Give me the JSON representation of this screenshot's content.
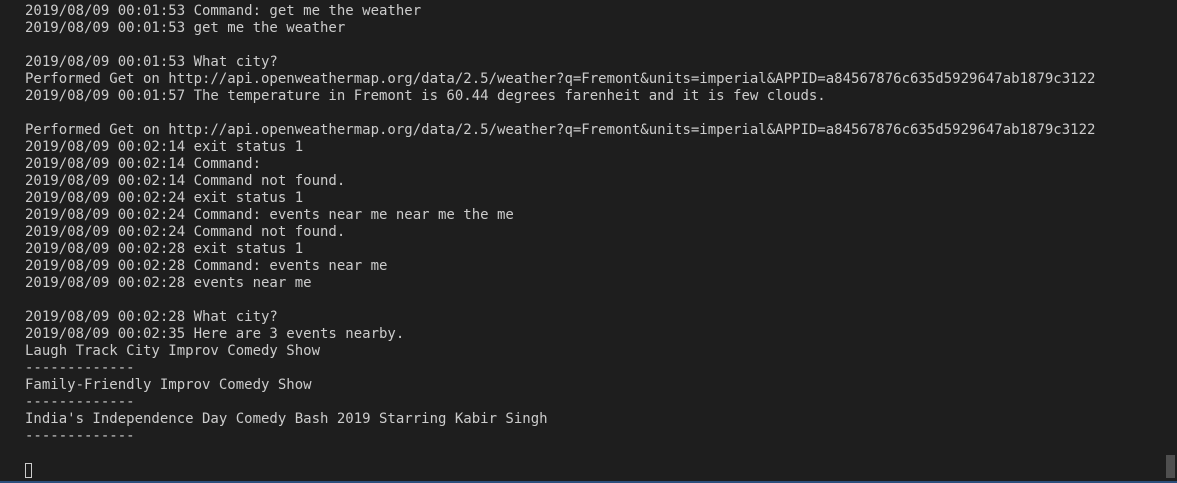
{
  "terminal": {
    "lines": [
      "2019/08/09 00:01:53 Command: get me the weather",
      "2019/08/09 00:01:53 get me the weather",
      "",
      "2019/08/09 00:01:53 What city?",
      "Performed Get on http://api.openweathermap.org/data/2.5/weather?q=Fremont&units=imperial&APPID=a84567876c635d5929647ab1879c3122",
      "2019/08/09 00:01:57 The temperature in Fremont is 60.44 degrees farenheit and it is few clouds.",
      "",
      "Performed Get on http://api.openweathermap.org/data/2.5/weather?q=Fremont&units=imperial&APPID=a84567876c635d5929647ab1879c3122",
      "2019/08/09 00:02:14 exit status 1",
      "2019/08/09 00:02:14 Command:",
      "2019/08/09 00:02:14 Command not found.",
      "2019/08/09 00:02:24 exit status 1",
      "2019/08/09 00:02:24 Command: events near me near me the me",
      "2019/08/09 00:02:24 Command not found.",
      "2019/08/09 00:02:28 exit status 1",
      "2019/08/09 00:02:28 Command: events near me",
      "2019/08/09 00:02:28 events near me",
      "",
      "2019/08/09 00:02:28 What city?",
      "2019/08/09 00:02:35 Here are 3 events nearby.",
      "Laugh Track City Improv Comedy Show",
      "-------------",
      "Family-Friendly Improv Comedy Show",
      "-------------",
      "India's Independence Day Comedy Bash 2019 Starring Kabir Singh",
      "-------------"
    ],
    "cursor_icon": "block-cursor-icon",
    "colors": {
      "background": "#1e1e1e",
      "text": "#cccccc",
      "bottom_border": "#2d4f7c",
      "scrollbar_thumb": "#4f4f4f"
    }
  }
}
